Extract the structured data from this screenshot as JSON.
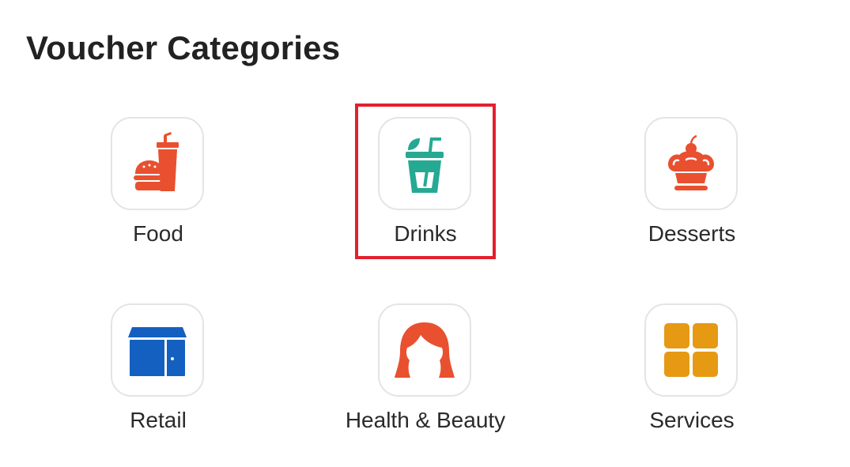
{
  "page": {
    "title": "Voucher Categories"
  },
  "categories": [
    {
      "label": "Food",
      "icon": "burger-drink-icon",
      "color": "#e8502f"
    },
    {
      "label": "Drinks",
      "icon": "cup-drink-icon",
      "color": "#25a993",
      "selected": true
    },
    {
      "label": "Desserts",
      "icon": "cake-icon",
      "color": "#e8502f"
    },
    {
      "label": "Retail",
      "icon": "store-icon",
      "color": "#1360c0"
    },
    {
      "label": "Health & Beauty",
      "icon": "woman-face-icon",
      "color": "#e8502f"
    },
    {
      "label": "Services",
      "icon": "grid-tiles-icon",
      "color": "#e69a14"
    }
  ],
  "colors": {
    "highlight": "#e3202e",
    "tile_border": "#e4e4e4"
  }
}
